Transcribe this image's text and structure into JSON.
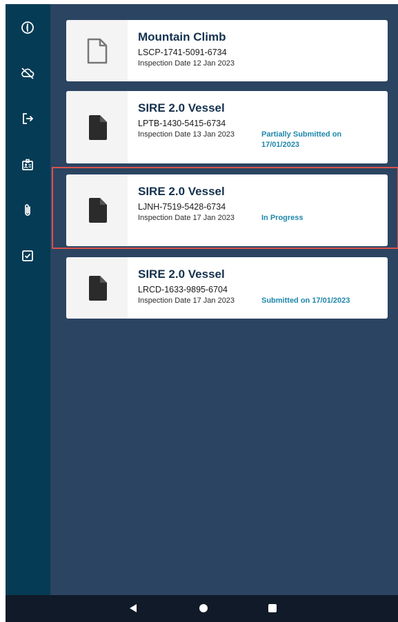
{
  "sidebar": {
    "icons": [
      {
        "name": "compass-icon"
      },
      {
        "name": "cloud-off-icon"
      },
      {
        "name": "logout-icon"
      },
      {
        "name": "id-badge-icon"
      },
      {
        "name": "paperclip-icon"
      },
      {
        "name": "checkbox-icon"
      }
    ]
  },
  "inspections": [
    {
      "title": "Mountain Climb",
      "code": "LSCP-1741-5091-6734",
      "date": "Inspection Date 12 Jan 2023",
      "status": "",
      "icon": "outline-document-icon"
    },
    {
      "title": "SIRE 2.0 Vessel",
      "code": "LPTB-1430-5415-6734",
      "date": "Inspection Date 13 Jan 2023",
      "status": "Partially Submitted on 17/01/2023",
      "icon": "filled-document-icon"
    },
    {
      "title": "SIRE 2.0 Vessel",
      "code": "LJNH-7519-5428-6734",
      "date": "Inspection Date 17 Jan 2023",
      "status": "In Progress",
      "icon": "filled-document-icon"
    },
    {
      "title": "SIRE 2.0 Vessel",
      "code": "LRCD-1633-9895-6704",
      "date": "Inspection Date 17 Jan 2023",
      "status": "Submitted on 17/01/2023",
      "icon": "filled-document-icon"
    }
  ],
  "colors": {
    "sidebar": "#053b55",
    "background": "#2b4461",
    "status": "#1f86ab",
    "title": "#15324f",
    "highlight": "#d9534f",
    "navbar": "#101a28"
  },
  "navbar": {
    "buttons": [
      "back-icon",
      "home-icon",
      "recents-icon"
    ]
  }
}
